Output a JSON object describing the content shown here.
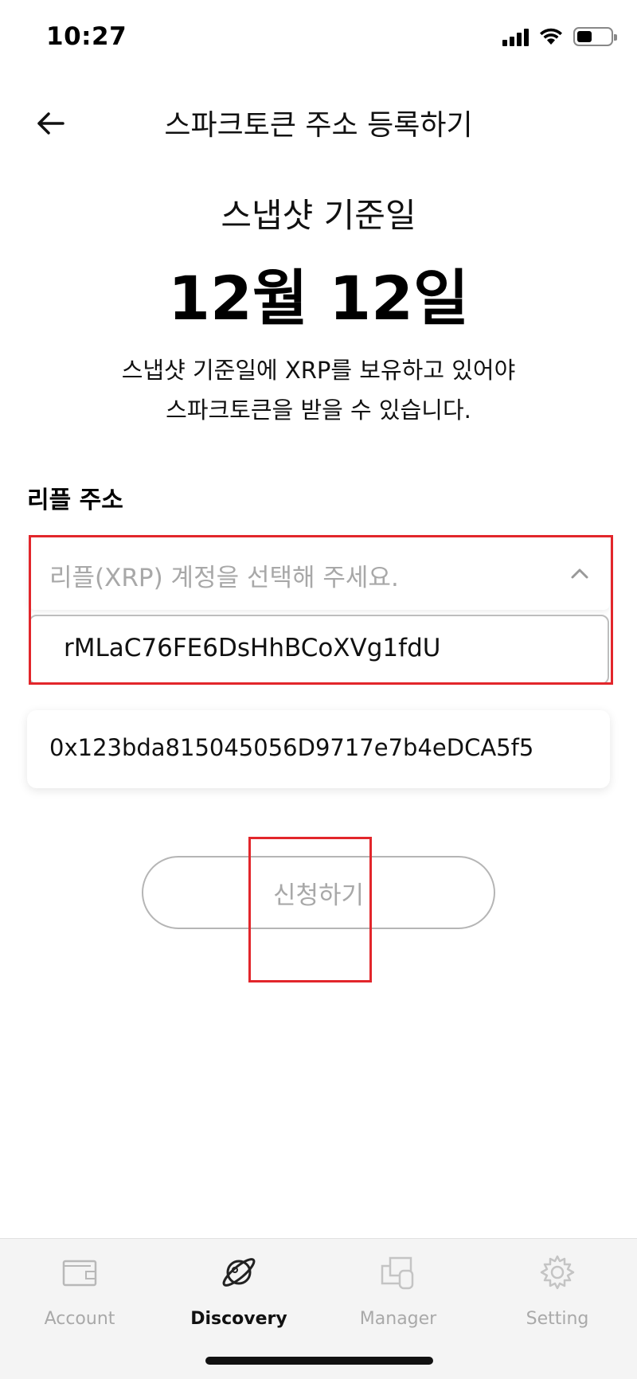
{
  "status_bar": {
    "time": "10:27"
  },
  "header": {
    "title": "스파크토큰 주소 등록하기",
    "back_icon": "arrow-left-icon"
  },
  "snapshot": {
    "label": "스냅샷 기준일",
    "date": "12월 12일",
    "notice_line1": "스냅샷 기준일에 XRP를 보유하고 있어야",
    "notice_line2": "스파크토큰을 받을 수 있습니다."
  },
  "form": {
    "field_label": "리플 주소",
    "dropdown_placeholder": "리플(XRP) 계정을 선택해 주세요.",
    "dropdown_option": "rMLaC76FE6DsHhBCoXVg1fdU",
    "address_value": "0x123bda815045056D9717e7b4eDCA5f5",
    "submit_label": "신청하기"
  },
  "tabs": [
    {
      "label": "Account",
      "icon": "wallet-icon",
      "active": false
    },
    {
      "label": "Discovery",
      "icon": "planet-icon",
      "active": true
    },
    {
      "label": "Manager",
      "icon": "cards-icon",
      "active": false
    },
    {
      "label": "Setting",
      "icon": "gear-icon",
      "active": false
    }
  ],
  "colors": {
    "annotation": "#e2262b",
    "inactive_text": "#a8a8a8",
    "tab_bar_bg": "#f4f4f4"
  }
}
